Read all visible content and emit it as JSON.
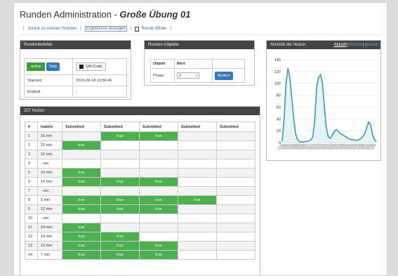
{
  "header": {
    "title_main": "Runden Administration - ",
    "title_sub": "Große Übung 01"
  },
  "links": {
    "back": "zurück zu meinen Runden",
    "results": "Ergebnisse anzeigen",
    "open": "Runde öffnen",
    "sep": "|"
  },
  "round_commands": {
    "title": "Rundenbefehle",
    "status": "active",
    "stop": "Stop",
    "qr": "QR-Code",
    "start_label": "Startzeit",
    "start_value": "2015-09-18 13:56:46",
    "end_label": "Endzeit",
    "end_value": "-"
  },
  "round_objects": {
    "title": "Runden-Objekte",
    "col_object": "Objekt",
    "col_value": "Wert",
    "row_label": "Phase",
    "row_value": "3",
    "change": "Ändern"
  },
  "users": {
    "title": "207 Nutzer",
    "columns": [
      "#",
      "Inaktiv",
      "Submitted",
      "Submitted",
      "Submitted",
      "Submitted",
      "Submitted"
    ],
    "rows": [
      [
        "1",
        "16 min",
        "",
        "true",
        "true",
        "",
        ""
      ],
      [
        "2",
        "22 min",
        "true",
        "",
        "",
        "",
        ""
      ],
      [
        "3",
        "15 min",
        "",
        "",
        "",
        "",
        ""
      ],
      [
        "4",
        "- sec",
        "",
        "",
        "",
        "",
        ""
      ],
      [
        "5",
        "23 min",
        "true",
        "",
        "",
        "",
        ""
      ],
      [
        "6",
        "14 min",
        "true",
        "true",
        "true",
        "",
        ""
      ],
      [
        "7",
        "- sec",
        "",
        "",
        "",
        "",
        ""
      ],
      [
        "8",
        "1 min",
        "true",
        "true",
        "true",
        "true",
        ""
      ],
      [
        "9",
        "12 min",
        "true",
        "true",
        "true",
        "",
        ""
      ],
      [
        "10",
        "- sec",
        "",
        "",
        "",
        "",
        ""
      ],
      [
        "11",
        "24 min",
        "true",
        "",
        "",
        "",
        ""
      ],
      [
        "12",
        "14 min",
        "true",
        "true",
        "",
        "",
        ""
      ],
      [
        "13",
        "13 min",
        "true",
        "true",
        "true",
        "",
        ""
      ],
      [
        "14",
        "7 min",
        "true",
        "true",
        "true",
        "",
        ""
      ]
    ]
  },
  "activity": {
    "title": "Aktivität der Nutzer",
    "range_current": "Aktuell",
    "range_2": "Woche",
    "range_3": "gesamt",
    "sep": "|"
  },
  "chart_data": {
    "type": "area",
    "title": "",
    "ylim": [
      0,
      140
    ],
    "yticks": [
      0,
      20,
      40,
      60,
      80,
      100,
      120,
      140
    ],
    "x": [
      "13:57",
      "13:58",
      "13:59",
      "14:00",
      "14:01",
      "14:02",
      "14:03",
      "14:04",
      "14:05",
      "14:06",
      "14:07",
      "14:08",
      "14:09",
      "14:10",
      "14:11",
      "14:12",
      "14:13",
      "14:14",
      "14:15",
      "14:16",
      "14:17",
      "14:18",
      "14:19",
      "14:20",
      "14:21",
      "14:22",
      "14:23",
      "14:24",
      "14:25",
      "14:26",
      "14:27",
      "14:28",
      "14:29",
      "14:30",
      "14:31",
      "14:32",
      "14:33",
      "14:34",
      "14:35",
      "14:36",
      "14:37",
      "14:38",
      "14:39",
      "14:40",
      "14:41",
      "14:42",
      "14:43",
      "14:44",
      "14:45",
      "14:46"
    ],
    "values": [
      2,
      40,
      100,
      125,
      110,
      75,
      40,
      15,
      5,
      2,
      1,
      1,
      2,
      2,
      3,
      5,
      10,
      40,
      95,
      110,
      115,
      100,
      60,
      25,
      10,
      7,
      12,
      18,
      22,
      20,
      16,
      14,
      12,
      10,
      8,
      6,
      5,
      5,
      4,
      4,
      5,
      7,
      10,
      15,
      25,
      35,
      30,
      15,
      5,
      2
    ],
    "grid": true,
    "colors": {
      "line": "#4aa3b8",
      "fill": "#e6f4f7"
    }
  }
}
